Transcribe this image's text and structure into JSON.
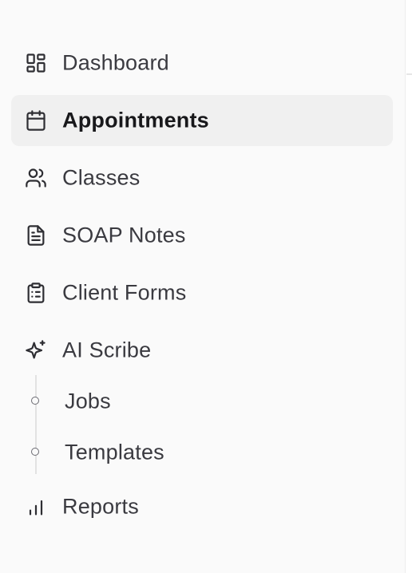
{
  "nav": {
    "items": [
      {
        "label": "Dashboard",
        "icon": "dashboard-icon",
        "active": false
      },
      {
        "label": "Appointments",
        "icon": "calendar-icon",
        "active": true
      },
      {
        "label": "Classes",
        "icon": "users-icon",
        "active": false
      },
      {
        "label": "SOAP Notes",
        "icon": "document-icon",
        "active": false
      },
      {
        "label": "Client Forms",
        "icon": "clipboard-list-icon",
        "active": false
      },
      {
        "label": "AI Scribe",
        "icon": "sparkles-icon",
        "active": false
      },
      {
        "label": "Reports",
        "icon": "bar-chart-icon",
        "active": false
      }
    ],
    "ai_scribe_children": [
      {
        "label": "Jobs"
      },
      {
        "label": "Templates"
      }
    ]
  },
  "colors": {
    "sidebar_bg": "#fafafa",
    "active_bg": "#f0f0f0",
    "text": "#3a3a40",
    "active_text": "#18181b"
  }
}
